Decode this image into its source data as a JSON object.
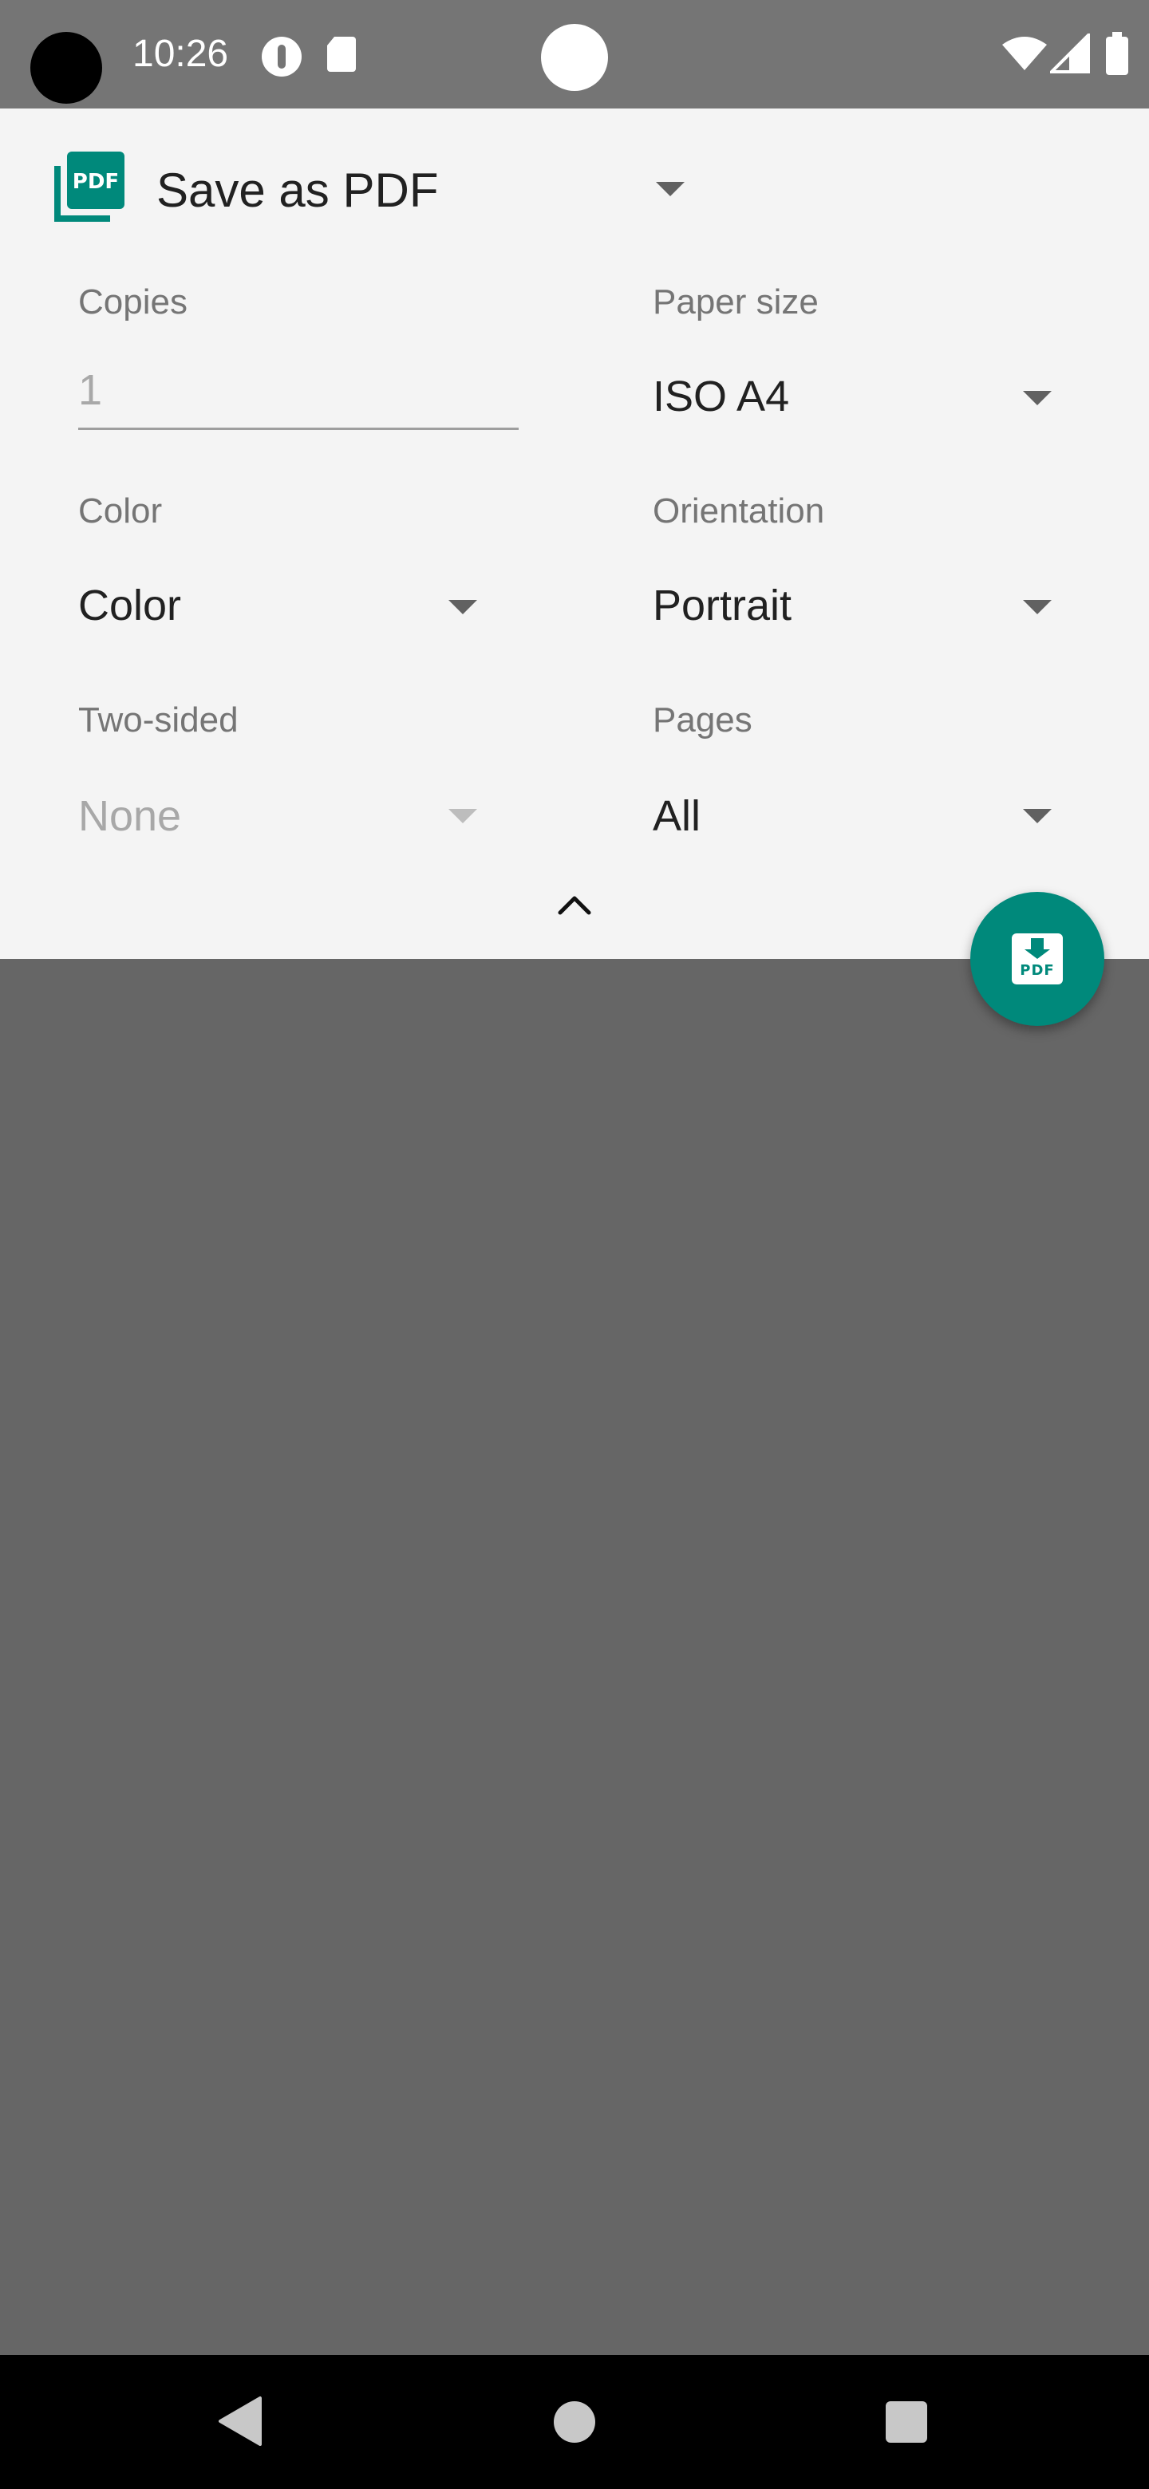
{
  "status_bar": {
    "time": "10:26",
    "icons": [
      "app-notification-icon",
      "sd-card-icon",
      "wifi-icon",
      "signal-icon",
      "battery-icon"
    ]
  },
  "printer": {
    "name": "Save as PDF",
    "logo_text": "PDF",
    "logo_color": "#00897b"
  },
  "fields": {
    "copies": {
      "label": "Copies",
      "placeholder": "1"
    },
    "paper_size": {
      "label": "Paper size",
      "value": "ISO A4"
    },
    "color": {
      "label": "Color",
      "value": "Color"
    },
    "orientation": {
      "label": "Orientation",
      "value": "Portrait"
    },
    "two_sided": {
      "label": "Two-sided",
      "value": "None",
      "disabled": true
    },
    "pages": {
      "label": "Pages",
      "value": "All"
    }
  },
  "fab": {
    "label": "PDF",
    "color": "#00897b",
    "icon": "pdf-download-icon"
  },
  "nav": {
    "icons": [
      "back-icon",
      "home-icon",
      "recents-icon"
    ]
  }
}
